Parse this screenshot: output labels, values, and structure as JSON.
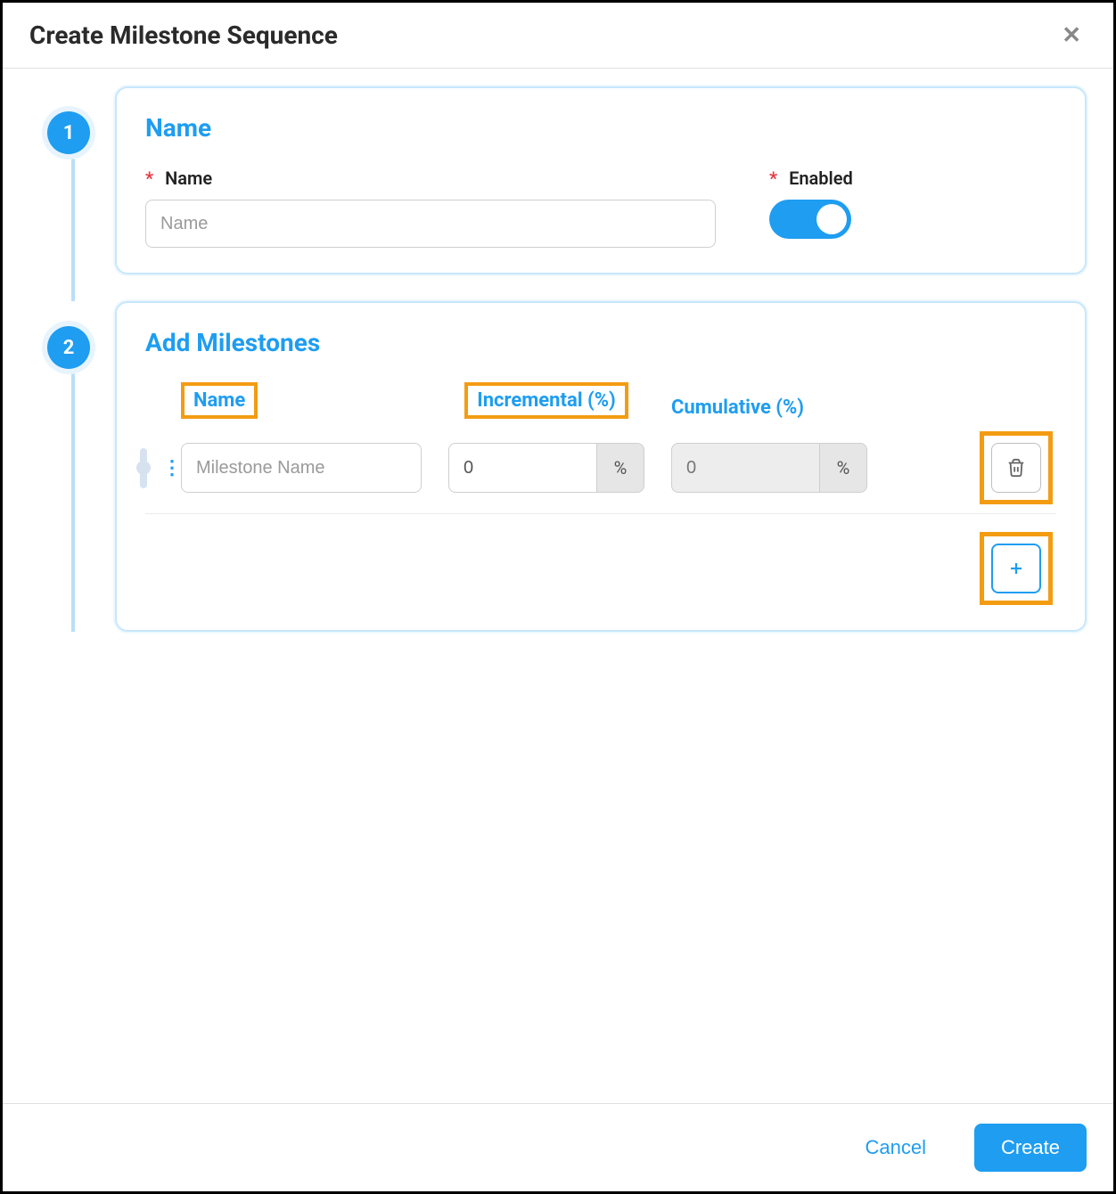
{
  "modal": {
    "title": "Create Milestone Sequence"
  },
  "steps": {
    "step1": {
      "number": "1",
      "title": "Name",
      "fields": {
        "name": {
          "label": "Name",
          "placeholder": "Name",
          "required": "*"
        },
        "enabled": {
          "label": "Enabled",
          "required": "*",
          "value": true
        }
      }
    },
    "step2": {
      "number": "2",
      "title": "Add Milestones",
      "columns": {
        "name": "Name",
        "incremental": "Incremental (%)",
        "cumulative": "Cumulative (%)"
      },
      "unit": "%",
      "rows": [
        {
          "name_placeholder": "Milestone Name",
          "incremental": "0",
          "cumulative": "0"
        }
      ]
    }
  },
  "footer": {
    "cancel": "Cancel",
    "create": "Create"
  }
}
